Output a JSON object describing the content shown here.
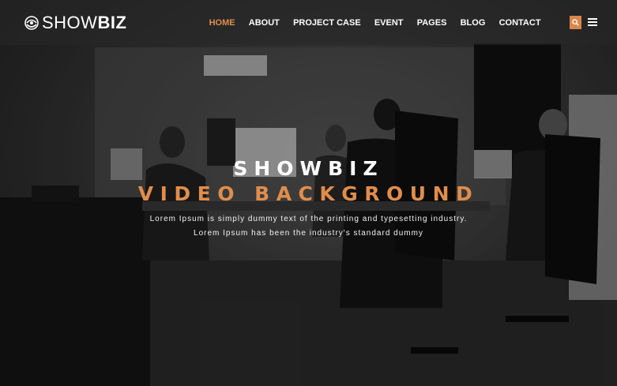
{
  "brand": {
    "light": "SHOW",
    "bold": "BIZ"
  },
  "nav": {
    "items": [
      {
        "label": "HOME",
        "active": true
      },
      {
        "label": "ABOUT"
      },
      {
        "label": "PROJECT CASE"
      },
      {
        "label": "EVENT"
      },
      {
        "label": "PAGES"
      },
      {
        "label": "BLOG"
      },
      {
        "label": "CONTACT"
      }
    ]
  },
  "header": {
    "search_icon": "search-icon",
    "menu_icon": "hamburger-menu-icon"
  },
  "hero": {
    "title_line1": "SHOWBIZ",
    "title_line2": "VIDEO BACKGROUND",
    "subtitle_line1": "Lorem Ipsum is simply dummy text of the printing and typesetting industry.",
    "subtitle_line2": "Lorem Ipsum has been the industry's standard dummy"
  },
  "colors": {
    "accent": "#e08d4c",
    "text": "#ffffff"
  }
}
